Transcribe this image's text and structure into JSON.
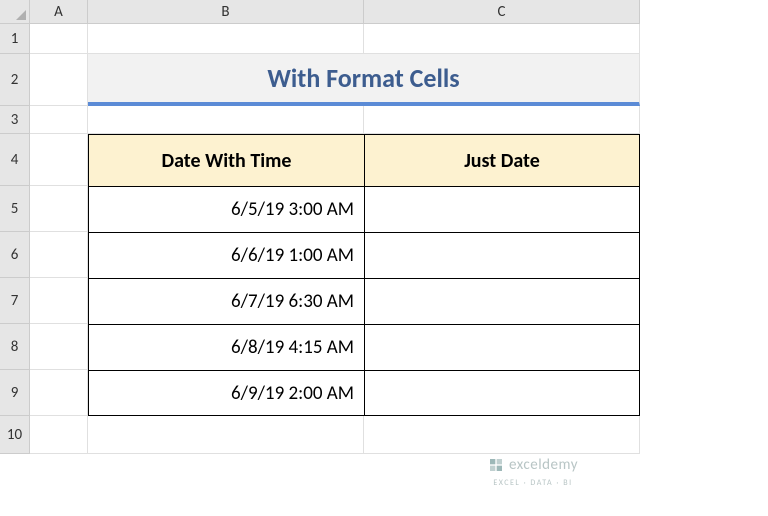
{
  "columns": [
    "A",
    "B",
    "C"
  ],
  "rows": [
    "1",
    "2",
    "3",
    "4",
    "5",
    "6",
    "7",
    "8",
    "9",
    "10"
  ],
  "title": "With Format Cells",
  "headers": {
    "date_with_time": "Date With Time",
    "just_date": "Just Date"
  },
  "data": [
    {
      "dwt": "6/5/19 3:00 AM",
      "jd": ""
    },
    {
      "dwt": "6/6/19 1:00 AM",
      "jd": ""
    },
    {
      "dwt": "6/7/19 6:30 AM",
      "jd": ""
    },
    {
      "dwt": "6/8/19 4:15 AM",
      "jd": ""
    },
    {
      "dwt": "6/9/19 2:00 AM",
      "jd": ""
    }
  ],
  "watermark": {
    "brand": "exceldemy",
    "tag": "EXCEL · DATA · BI"
  }
}
